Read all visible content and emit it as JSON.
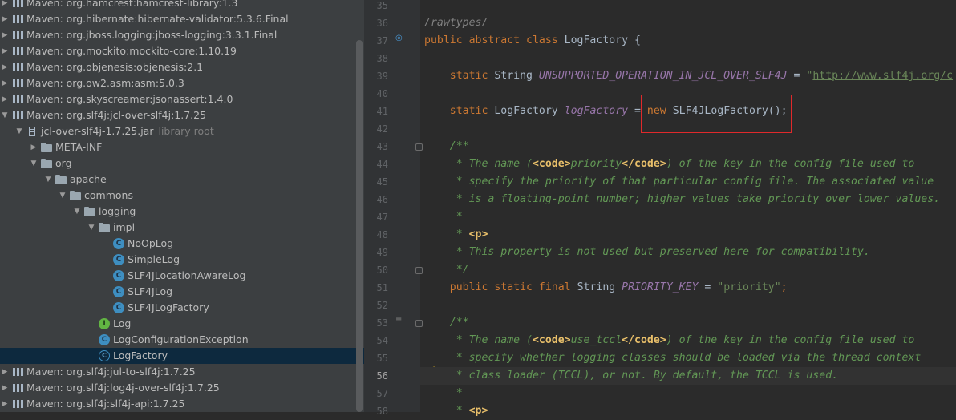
{
  "project_tree": {
    "rows": [
      {
        "label": "Maven: org.hamcrest:hamcrest-library:1.3",
        "suffix": "",
        "icon": "library-icon",
        "expanded": false
      },
      {
        "label": "Maven: org.hibernate:hibernate-validator:5.3.6.Final",
        "suffix": "",
        "icon": "library-icon",
        "expanded": false
      },
      {
        "label": "Maven: org.jboss.logging:jboss-logging:3.3.1.Final",
        "suffix": "",
        "icon": "library-icon",
        "expanded": false
      },
      {
        "label": "Maven: org.mockito:mockito-core:1.10.19",
        "suffix": "",
        "icon": "library-icon",
        "expanded": false
      },
      {
        "label": "Maven: org.objenesis:objenesis:2.1",
        "suffix": "",
        "icon": "library-icon",
        "expanded": false
      },
      {
        "label": "Maven: org.ow2.asm:asm:5.0.3",
        "suffix": "",
        "icon": "library-icon",
        "expanded": false
      },
      {
        "label": "Maven: org.skyscreamer:jsonassert:1.4.0",
        "suffix": "",
        "icon": "library-icon",
        "expanded": false
      },
      {
        "label": "Maven: org.slf4j:jcl-over-slf4j:1.7.25",
        "suffix": "",
        "icon": "library-icon",
        "expanded": true
      },
      {
        "label": "jcl-over-slf4j-1.7.25.jar",
        "suffix": "library root",
        "icon": "jar-icon",
        "expanded": true
      },
      {
        "label": "META-INF",
        "suffix": "",
        "icon": "folder-icon",
        "expanded": false
      },
      {
        "label": "org",
        "suffix": "",
        "icon": "folder-icon",
        "expanded": true
      },
      {
        "label": "apache",
        "suffix": "",
        "icon": "folder-icon",
        "expanded": true
      },
      {
        "label": "commons",
        "suffix": "",
        "icon": "folder-icon",
        "expanded": true
      },
      {
        "label": "logging",
        "suffix": "",
        "icon": "folder-icon",
        "expanded": true
      },
      {
        "label": "impl",
        "suffix": "",
        "icon": "folder-icon",
        "expanded": true
      },
      {
        "label": "NoOpLog",
        "suffix": "",
        "icon": "class-icon"
      },
      {
        "label": "SimpleLog",
        "suffix": "",
        "icon": "class-icon"
      },
      {
        "label": "SLF4JLocationAwareLog",
        "suffix": "",
        "icon": "class-icon"
      },
      {
        "label": "SLF4JLog",
        "suffix": "",
        "icon": "class-icon"
      },
      {
        "label": "SLF4JLogFactory",
        "suffix": "",
        "icon": "class-icon"
      },
      {
        "label": "Log",
        "suffix": "",
        "icon": "interface-icon"
      },
      {
        "label": "LogConfigurationException",
        "suffix": "",
        "icon": "exception-class-icon"
      },
      {
        "label": "LogFactory",
        "suffix": "",
        "icon": "abstract-class-icon",
        "selected": true
      },
      {
        "label": "Maven: org.slf4j:jul-to-slf4j:1.7.25",
        "suffix": "",
        "icon": "library-icon",
        "expanded": false
      },
      {
        "label": "Maven: org.slf4j:log4j-over-slf4j:1.7.25",
        "suffix": "",
        "icon": "library-icon",
        "expanded": false
      },
      {
        "label": "Maven: org.slf4j:slf4j-api:1.7.25",
        "suffix": "",
        "icon": "library-icon",
        "expanded": false
      }
    ]
  },
  "editor": {
    "current_line": "56",
    "lines": [
      {
        "num": "35",
        "segments": []
      },
      {
        "num": "36",
        "segments": [
          {
            "t": "/rawtypes/",
            "c": "cmt"
          }
        ]
      },
      {
        "num": "37",
        "segments": [
          {
            "t": "public abstract class ",
            "c": "kw"
          },
          {
            "t": "LogFactory {",
            "c": "plain"
          }
        ]
      },
      {
        "num": "38",
        "segments": []
      },
      {
        "num": "39",
        "segments": [
          {
            "t": "    static ",
            "c": "kw"
          },
          {
            "t": "String ",
            "c": "plain"
          },
          {
            "t": "UNSUPPORTED_OPERATION_IN_JCL_OVER_SLF4J",
            "c": "fld"
          },
          {
            "t": " = ",
            "c": "plain"
          },
          {
            "t": "\"",
            "c": "str"
          },
          {
            "t": "http://www.slf4j.org/c",
            "c": "link"
          }
        ]
      },
      {
        "num": "40",
        "segments": []
      },
      {
        "num": "41",
        "segments": [
          {
            "t": "    static ",
            "c": "kw"
          },
          {
            "t": "LogFactory ",
            "c": "plain"
          },
          {
            "t": "logFactory",
            "c": "fld"
          },
          {
            "t": " = ",
            "c": "plain"
          },
          {
            "t": "new ",
            "c": "kw"
          },
          {
            "t": "SLF4JLogFactory();",
            "c": "plain"
          }
        ]
      },
      {
        "num": "42",
        "segments": []
      },
      {
        "num": "43",
        "segments": [
          {
            "t": "    /**",
            "c": "doc"
          }
        ]
      },
      {
        "num": "44",
        "segments": [
          {
            "t": "     * The name (",
            "c": "doc"
          },
          {
            "t": "<code>",
            "c": "tag"
          },
          {
            "t": "priority",
            "c": "doc"
          },
          {
            "t": "</code>",
            "c": "tag"
          },
          {
            "t": ") of the key in the config file used to",
            "c": "doc"
          }
        ]
      },
      {
        "num": "45",
        "segments": [
          {
            "t": "     * specify the priority of that particular config file. The associated value",
            "c": "doc"
          }
        ]
      },
      {
        "num": "46",
        "segments": [
          {
            "t": "     * is a floating-point number; higher values take priority over lower values.",
            "c": "doc"
          }
        ]
      },
      {
        "num": "47",
        "segments": [
          {
            "t": "     *",
            "c": "doc"
          }
        ]
      },
      {
        "num": "48",
        "segments": [
          {
            "t": "     * ",
            "c": "doc"
          },
          {
            "t": "<p>",
            "c": "tag"
          }
        ]
      },
      {
        "num": "49",
        "segments": [
          {
            "t": "     * This property is not used but preserved here for compatibility.",
            "c": "doc"
          }
        ]
      },
      {
        "num": "50",
        "segments": [
          {
            "t": "     */",
            "c": "doc"
          }
        ]
      },
      {
        "num": "51",
        "segments": [
          {
            "t": "    public static final ",
            "c": "kw"
          },
          {
            "t": "String ",
            "c": "plain"
          },
          {
            "t": "PRIORITY_KEY",
            "c": "fld"
          },
          {
            "t": " = ",
            "c": "plain"
          },
          {
            "t": "\"priority\"",
            "c": "str"
          },
          {
            "t": ";",
            "c": "kw"
          }
        ]
      },
      {
        "num": "52",
        "segments": []
      },
      {
        "num": "53",
        "segments": [
          {
            "t": "    /**",
            "c": "doc"
          }
        ]
      },
      {
        "num": "54",
        "segments": [
          {
            "t": "     * The name (",
            "c": "doc"
          },
          {
            "t": "<code>",
            "c": "tag"
          },
          {
            "t": "use_tccl",
            "c": "doc"
          },
          {
            "t": "</code>",
            "c": "tag"
          },
          {
            "t": ") of the key in the config file used to",
            "c": "doc"
          }
        ]
      },
      {
        "num": "55",
        "segments": [
          {
            "t": "     * specify whether logging classes should be loaded via the thread context",
            "c": "doc"
          }
        ]
      },
      {
        "num": "56",
        "segments": [
          {
            "t": "     * class loader (TCCL), or not. By default, the TCCL is used.",
            "c": "doc"
          }
        ]
      },
      {
        "num": "57",
        "segments": [
          {
            "t": "     *",
            "c": "doc"
          }
        ]
      },
      {
        "num": "58",
        "segments": [
          {
            "t": "     * ",
            "c": "doc"
          },
          {
            "t": "<p>",
            "c": "tag"
          }
        ]
      }
    ]
  },
  "colors": {
    "highlight_box": "#e0292b",
    "selection": "#0d293e"
  }
}
